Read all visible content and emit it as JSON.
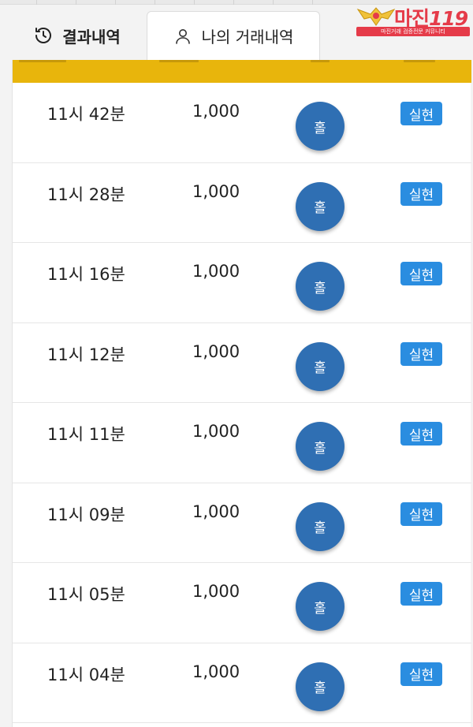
{
  "tabs": {
    "history_label": "결과내역",
    "my_label": "나의 거래내역"
  },
  "logo": {
    "name": "마진",
    "number": "119",
    "tagline": "마진거래 검증전문 커뮤니티"
  },
  "colors": {
    "header_bar": "#e8b50c",
    "ball": "#2f6fb3",
    "badge": "#2a8de0"
  },
  "rows": [
    {
      "time": "11시 42분",
      "amount": "1,000",
      "pick": "홀",
      "status": "실현"
    },
    {
      "time": "11시 28분",
      "amount": "1,000",
      "pick": "홀",
      "status": "실현"
    },
    {
      "time": "11시 16분",
      "amount": "1,000",
      "pick": "홀",
      "status": "실현"
    },
    {
      "time": "11시 12분",
      "amount": "1,000",
      "pick": "홀",
      "status": "실현"
    },
    {
      "time": "11시 11분",
      "amount": "1,000",
      "pick": "홀",
      "status": "실현"
    },
    {
      "time": "11시 09분",
      "amount": "1,000",
      "pick": "홀",
      "status": "실현"
    },
    {
      "time": "11시 05분",
      "amount": "1,000",
      "pick": "홀",
      "status": "실현"
    },
    {
      "time": "11시 04분",
      "amount": "1,000",
      "pick": "홀",
      "status": "실현"
    }
  ]
}
